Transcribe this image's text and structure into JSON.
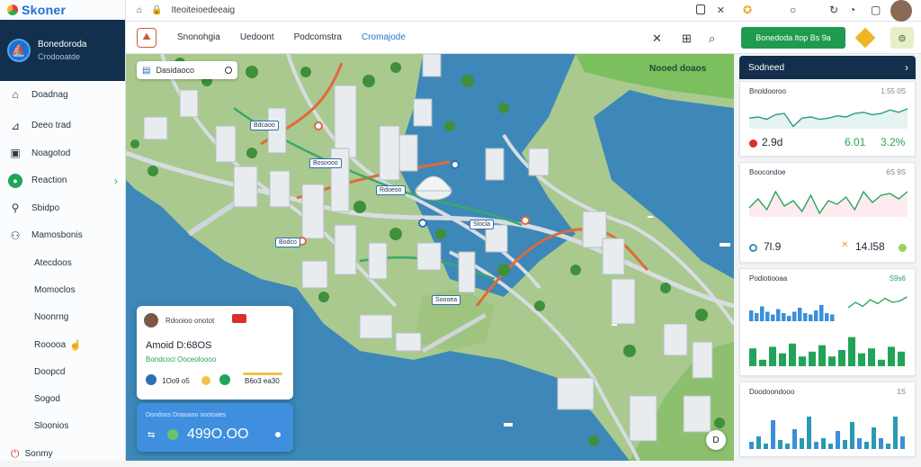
{
  "brand": {
    "name": "Skoner"
  },
  "company": {
    "line1": "Bonedoroda",
    "line2": "Crodooatde"
  },
  "sidebar": {
    "items": [
      {
        "label": "Doadnag",
        "icon": "home-icon"
      },
      {
        "label": "Deeo trad",
        "icon": "chart-icon"
      },
      {
        "label": "Noagotod",
        "icon": "grid-icon"
      },
      {
        "label": "Reaction",
        "icon": "leaf-icon"
      },
      {
        "label": "Sbidpo",
        "icon": "person-icon"
      },
      {
        "label": "Mamosbonis",
        "icon": "people-icon"
      }
    ],
    "subitems": [
      "Atecdoos",
      "Momoclos",
      "Noonrng",
      "Rooooa",
      "Doopcd",
      "Sogod",
      "Sloonios"
    ],
    "bottom": {
      "label": "Sonmy",
      "icon": "power-icon"
    }
  },
  "urlbar": {
    "text": "Iteoiteioedeeaig"
  },
  "toolbar": {
    "tabs": [
      "Snonohgia",
      "Uedoont",
      "Podcomstra",
      "Cromajode"
    ]
  },
  "map": {
    "search": "Dasidaoco",
    "area_label": "Nooed doaos",
    "pins": [
      "Bdcaoo",
      "Bosoooo",
      "Rdoeoo",
      "Bodco",
      "Slocla",
      "Soooea"
    ],
    "info_card": {
      "who": "Rdooioo onotot",
      "title": "Amoid D:68OS",
      "subtitle": "Bondcoci Ooceoloooo",
      "value1": "1Oo9 o5",
      "value2": "B6o3 ea30"
    },
    "total_card": {
      "label": "Dondoos Doaoaoo oootoaes",
      "amount": "499O.OO"
    },
    "fab": "D"
  },
  "right": {
    "action_label": "Bonedoda ltop Bs 9a",
    "header": "Sodneed",
    "cards": [
      {
        "title": "Bnoldooroo",
        "value": "1:55 0S",
        "footer_left": "2.9d",
        "footer_mid": "6.01",
        "footer_right": "3.2%",
        "line": [
          0.55,
          0.5,
          0.6,
          0.4,
          0.35,
          0.9,
          0.55,
          0.5,
          0.6,
          0.55,
          0.45,
          0.5,
          0.35,
          0.3,
          0.4,
          0.35,
          0.2,
          0.3,
          0.15
        ],
        "color": "#2a9a8a"
      },
      {
        "title": "Boocondoe",
        "value": "6S 9S",
        "footer_left": "7l.9",
        "footer_right": "14.l58",
        "line": [
          0.75,
          0.5,
          0.8,
          0.3,
          0.7,
          0.55,
          0.85,
          0.4,
          0.9,
          0.55,
          0.65,
          0.45,
          0.8,
          0.3,
          0.6,
          0.4,
          0.35,
          0.5,
          0.3
        ],
        "color": "#26a65b"
      },
      {
        "title": "Podiotiooaa",
        "value": "S9s6",
        "bars_blue": [
          0.4,
          0.3,
          0.55,
          0.35,
          0.25,
          0.45,
          0.3,
          0.2,
          0.35,
          0.5,
          0.3,
          0.25,
          0.4,
          0.6,
          0.3,
          0.25
        ],
        "bars_green": [
          0.55,
          0.2,
          0.6,
          0.4,
          0.7,
          0.3,
          0.45,
          0.65,
          0.3,
          0.5,
          0.9,
          0.4,
          0.55,
          0.2,
          0.6,
          0.45
        ]
      },
      {
        "title": "Doodoondooo",
        "value": "1S",
        "bars": [
          0.2,
          0.35,
          0.15,
          0.8,
          0.25,
          0.15,
          0.55,
          0.3,
          0.9,
          0.2,
          0.3,
          0.15,
          0.5,
          0.25,
          0.75,
          0.3,
          0.2,
          0.6,
          0.3,
          0.15,
          0.9,
          0.35
        ]
      }
    ]
  }
}
